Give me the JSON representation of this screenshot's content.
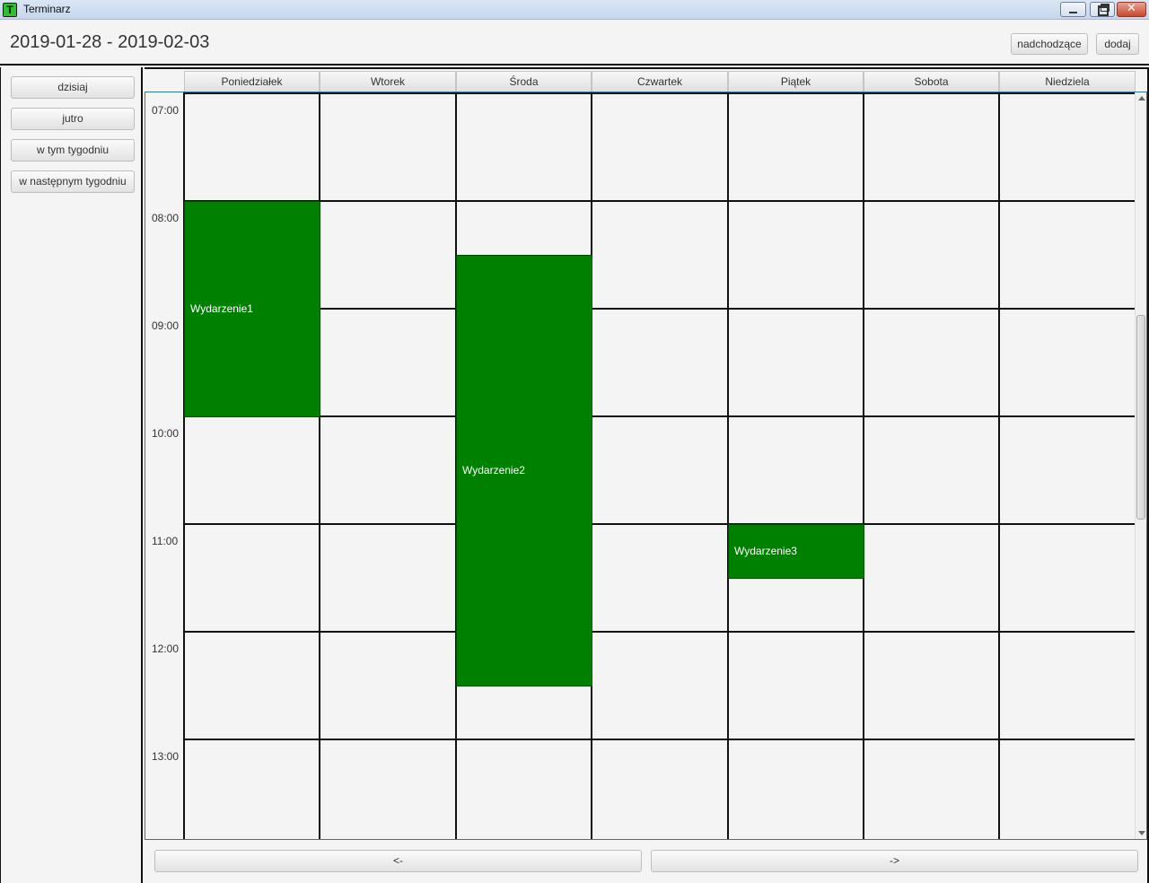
{
  "window": {
    "title": "Terminarz",
    "icon_letter": "T",
    "close_glyph": "✕"
  },
  "header": {
    "date_range": "2019-01-28 - 2019-02-03",
    "upcoming_label": "nadchodzące",
    "add_label": "dodaj"
  },
  "sidebar": {
    "items": [
      {
        "label": "dzisiaj"
      },
      {
        "label": "jutro"
      },
      {
        "label": "w tym tygodniu"
      },
      {
        "label": "w następnym tygodniu"
      }
    ]
  },
  "days": [
    "Poniedziałek",
    "Wtorek",
    "Środa",
    "Czwartek",
    "Piątek",
    "Sobota",
    "Niedziela"
  ],
  "hours": [
    "07:00",
    "08:00",
    "09:00",
    "10:00",
    "11:00",
    "12:00",
    "13:00"
  ],
  "events": [
    {
      "title": "Wydarzenie1",
      "day": "Poniedziałek",
      "start": "08:00",
      "end": "10:00",
      "color": "#008000"
    },
    {
      "title": "Wydarzenie2",
      "day": "Środa",
      "start": "08:30",
      "end": "12:30",
      "color": "#008000"
    },
    {
      "title": "Wydarzenie3",
      "day": "Piątek",
      "start": "11:00",
      "end": "11:30",
      "color": "#008000"
    }
  ],
  "navigation": {
    "prev_label": "<-",
    "next_label": "->"
  },
  "colors": {
    "event": "#008000",
    "grid_line": "#111111",
    "background": "#f4f4f4"
  }
}
